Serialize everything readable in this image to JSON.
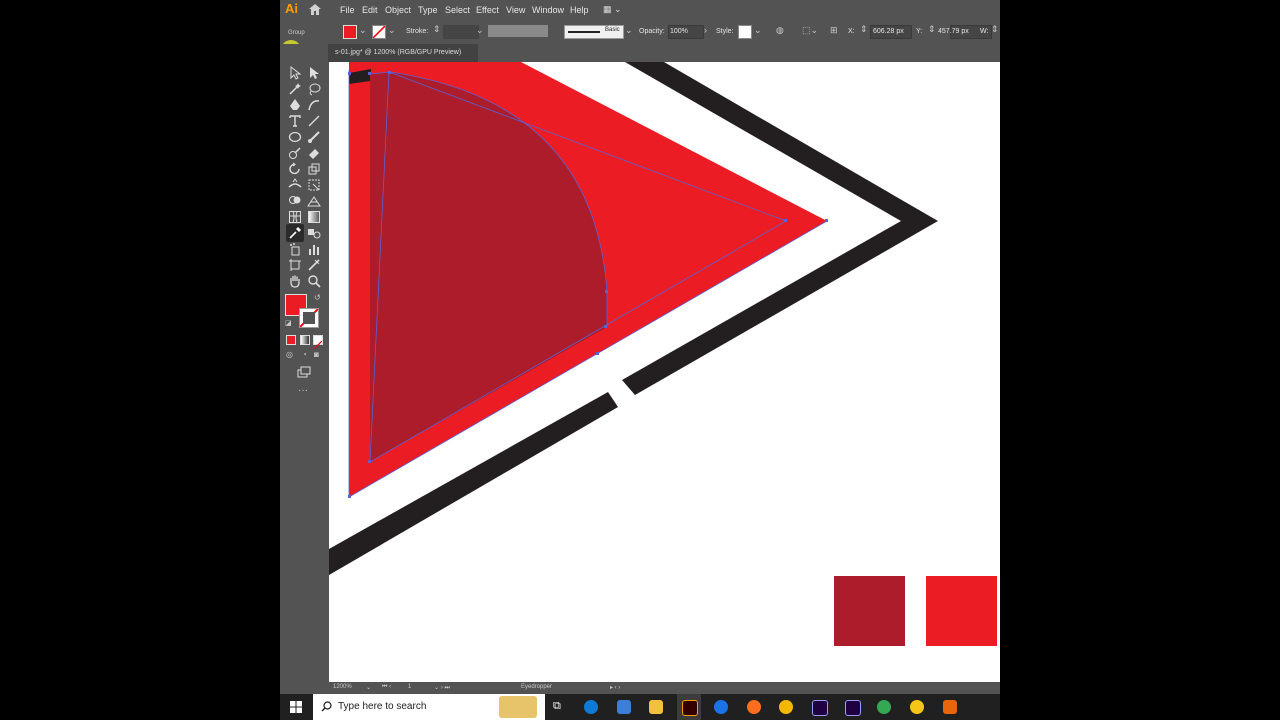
{
  "app": {
    "logo": "Ai"
  },
  "menu": {
    "items": [
      "File",
      "Edit",
      "Object",
      "Type",
      "Select",
      "Effect",
      "View",
      "Window",
      "Help"
    ]
  },
  "control_bar": {
    "selection": "Group",
    "stroke_label": "Stroke:",
    "brush": "Basic",
    "opacity_label": "Opacity:",
    "opacity_value": "100%",
    "style_label": "Style:",
    "x_label": "X:",
    "x_value": "606.28 px",
    "y_label": "Y:",
    "y_value": "457.79 px",
    "w_label": "W:"
  },
  "document": {
    "tab_title": "s-01.jpg* @ 1200% (RGB/GPU Preview)"
  },
  "status": {
    "zoom": "1200%",
    "artboard": "1",
    "tool": "Eyedropper"
  },
  "taskbar": {
    "search_placeholder": "Type here to search"
  },
  "colors": {
    "fill": "#ec1c24",
    "dark_red": "#ac1c2a",
    "stroke_black": "#231f20",
    "ui_bg": "#535353",
    "path_blue": "#5a62d6"
  }
}
